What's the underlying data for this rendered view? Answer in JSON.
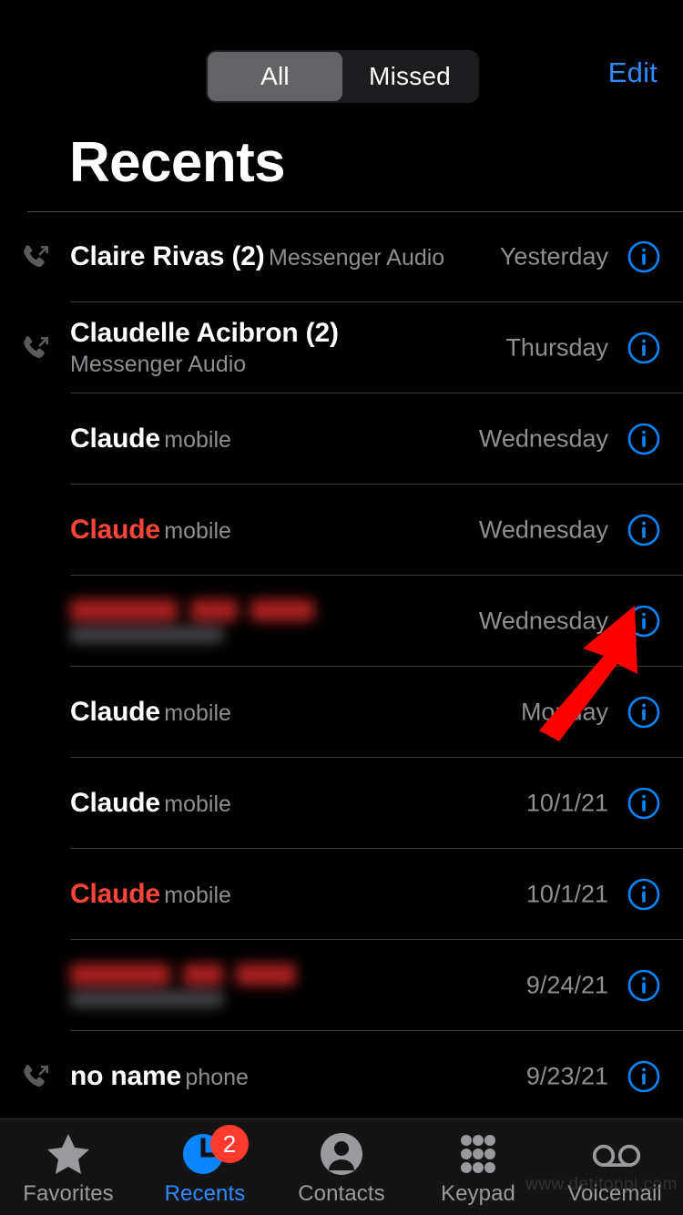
{
  "header": {
    "segments": [
      {
        "label": "All",
        "selected": true
      },
      {
        "label": "Missed",
        "selected": false
      }
    ],
    "edit_label": "Edit",
    "title": "Recents",
    "accent_color": "#2e8bff"
  },
  "calls": [
    {
      "name": "Claire Rivas (2)",
      "subtitle": "Messenger Audio",
      "date": "Yesterday",
      "missed": false,
      "call_icon": "outgoing-call-icon",
      "redacted": false
    },
    {
      "name": "Claudelle Acibron (2)",
      "subtitle": "Messenger Audio",
      "date": "Thursday",
      "missed": false,
      "call_icon": "outgoing-call-icon",
      "redacted": false
    },
    {
      "name": "Claude",
      "subtitle": "mobile",
      "date": "Wednesday",
      "missed": false,
      "call_icon": null,
      "redacted": false
    },
    {
      "name": "Claude",
      "subtitle": "mobile",
      "date": "Wednesday",
      "missed": true,
      "call_icon": null,
      "redacted": false
    },
    {
      "name": "",
      "subtitle": "",
      "date": "Wednesday",
      "missed": true,
      "call_icon": null,
      "redacted": true,
      "redact_widths": [
        118,
        52,
        70
      ]
    },
    {
      "name": "Claude",
      "subtitle": "mobile",
      "date": "Monday",
      "missed": false,
      "call_icon": null,
      "redacted": false
    },
    {
      "name": "Claude",
      "subtitle": "mobile",
      "date": "10/1/21",
      "missed": false,
      "call_icon": null,
      "redacted": false
    },
    {
      "name": "Claude",
      "subtitle": "mobile",
      "date": "10/1/21",
      "missed": true,
      "call_icon": null,
      "redacted": false
    },
    {
      "name": "",
      "subtitle": "",
      "date": "9/24/21",
      "missed": true,
      "call_icon": null,
      "redacted": true,
      "redact_widths": [
        110,
        44,
        66
      ]
    },
    {
      "name": "no name",
      "subtitle": "phone",
      "date": "9/23/21",
      "missed": false,
      "call_icon": "outgoing-call-icon",
      "redacted": false
    }
  ],
  "info_button_label": "i",
  "annotation": {
    "type": "red-arrow",
    "color": "#ff0000",
    "points_to": "info-button-row-5"
  },
  "tabbar": {
    "items": [
      {
        "label": "Favorites",
        "icon": "star-icon",
        "active": false,
        "badge": null
      },
      {
        "label": "Recents",
        "icon": "clock-icon",
        "active": true,
        "badge": "2"
      },
      {
        "label": "Contacts",
        "icon": "person-icon",
        "active": false,
        "badge": null
      },
      {
        "label": "Keypad",
        "icon": "keypad-icon",
        "active": false,
        "badge": null
      },
      {
        "label": "Voicemail",
        "icon": "voicemail-icon",
        "active": false,
        "badge": null
      }
    ]
  },
  "watermark": "www.detitoppi.com"
}
